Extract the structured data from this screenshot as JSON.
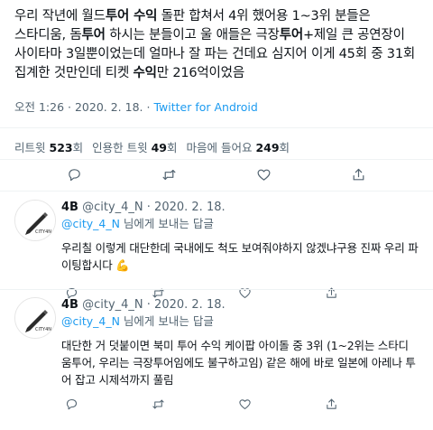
{
  "tweet": {
    "segments": [
      {
        "t": "우리 작년에 월드",
        "b": false
      },
      {
        "t": "투어 수익",
        "b": true
      },
      {
        "t": " 돌판 합쳐서 4위 했어용 1~3위 분들은 스타디움, 돔",
        "b": false
      },
      {
        "t": "투어",
        "b": true
      },
      {
        "t": " 하시는 분들이고 울 애들은 극장",
        "b": false
      },
      {
        "t": "투어",
        "b": true
      },
      {
        "t": "+제일 큰 공연장이 사이타마 3일뿐이었는데 얼마나 잘 파는 건데요 심지어 이게 45회 중 31회 집계한 것만인데 티켓 ",
        "b": false
      },
      {
        "t": "수익",
        "b": true
      },
      {
        "t": "만 216억이었음",
        "b": false
      }
    ],
    "time": "오전 1:26 · 2020. 2. 18.",
    "client": "Twitter for Android"
  },
  "stats": {
    "retweets_label": "리트윗",
    "retweets_count": "523",
    "retweets_suffix": "회",
    "quotes_label": "인용한 트윗",
    "quotes_count": "49",
    "quotes_suffix": "회",
    "likes_label": "마음에 들어요",
    "likes_count": "249",
    "likes_suffix": "회"
  },
  "icons": {
    "reply": "reply-icon",
    "retweet": "retweet-icon",
    "like": "heart-icon",
    "share": "share-icon"
  },
  "replies": [
    {
      "name": "4B",
      "handle": "@city_4_N",
      "date": "· 2020. 2. 18.",
      "to_handle": "@city_4_N",
      "to_suffix": " 님에게 보내는 답글",
      "text": "우리칠 이렇게 대단한데 국내에도 척도 보여줘야하지 않겠냐구용 진짜 우리 파이팅합시다 💪",
      "avatar_text": "CITY4N"
    },
    {
      "name": "4B",
      "handle": "@city_4_N",
      "date": "· 2020. 2. 18.",
      "to_handle": "@city_4_N",
      "to_suffix": " 님에게 보내는 답글",
      "text": "대단한 거 덧붙이면 북미 투어 수익 케이팝 아이돌 중 3위 (1~2위는 스타디움투어, 우리는 극장투어임에도 불구하고임) 같은 해에 바로 일본에 아레나 투어 잡고 시제석까지 풀림",
      "avatar_text": "CITY4N"
    }
  ],
  "colors": {
    "text": "#0f1419",
    "secondary": "#536471",
    "accent": "#1d9bf0",
    "divider": "#eff3f4"
  }
}
